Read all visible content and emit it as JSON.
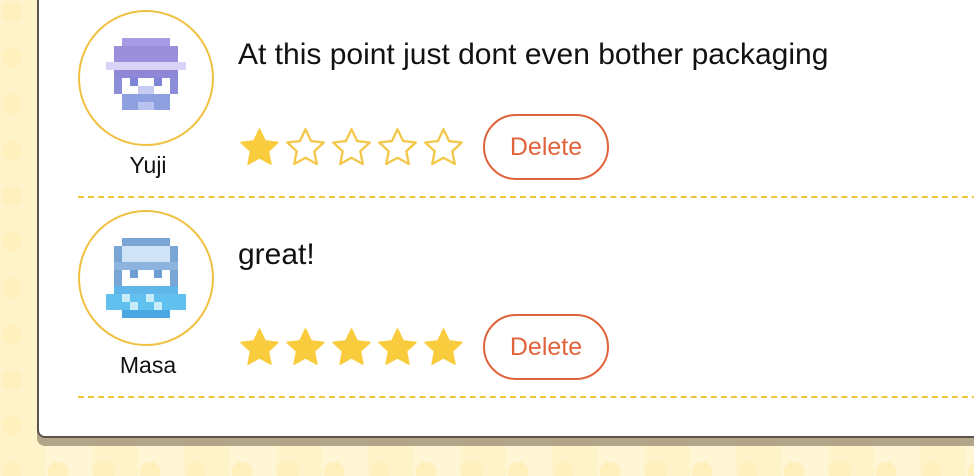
{
  "reviews": [
    {
      "username": "Yuji",
      "comment": "At this point just dont even bother packaging",
      "rating": 1,
      "max_rating": 5,
      "delete_label": "Delete",
      "avatar_color": "#9b8fdc"
    },
    {
      "username": "Masa",
      "comment": "great!",
      "rating": 5,
      "max_rating": 5,
      "delete_label": "Delete",
      "avatar_color": "#6fb0e6"
    }
  ],
  "colors": {
    "star_filled": "#f9cc3d",
    "star_empty_stroke": "#f3c84a",
    "delete_accent": "#e0643a",
    "separator": "#f1c53b"
  }
}
